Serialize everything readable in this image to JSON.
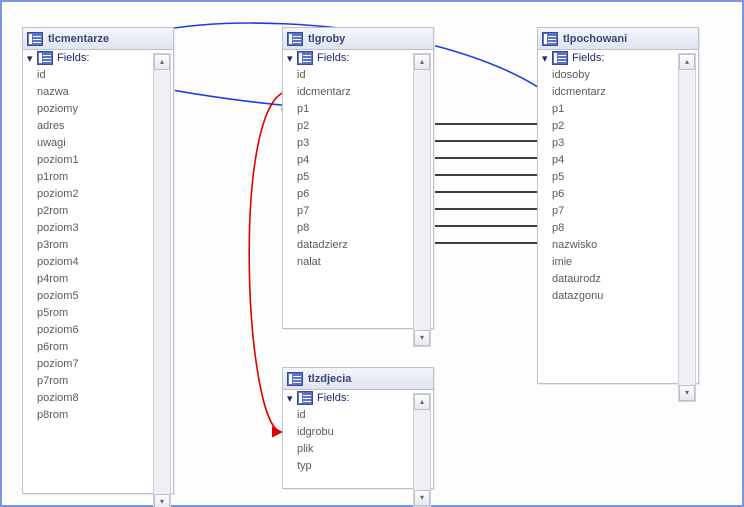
{
  "fieldsLabel": "Fields:",
  "tables": [
    {
      "name": "tlcmentarze",
      "fields": [
        "id",
        "nazwa",
        "poziomy",
        "adres",
        "uwagi",
        "poziom1",
        "p1rom",
        "poziom2",
        "p2rom",
        "poziom3",
        "p3rom",
        "poziom4",
        "p4rom",
        "poziom5",
        "p5rom",
        "poziom6",
        "p6rom",
        "poziom7",
        "p7rom",
        "poziom8",
        "p8rom"
      ]
    },
    {
      "name": "tlgroby",
      "fields": [
        "id",
        "idcmentarz",
        "p1",
        "p2",
        "p3",
        "p4",
        "p5",
        "p6",
        "p7",
        "p8",
        "datadzierz",
        "nalat"
      ]
    },
    {
      "name": "tlpochowani",
      "fields": [
        "idosoby",
        "idcmentarz",
        "p1",
        "p2",
        "p3",
        "p4",
        "p5",
        "p6",
        "p7",
        "p8",
        "nazwisko",
        "imie",
        "dataurodz",
        "datazgonu"
      ]
    },
    {
      "name": "tlzdjecia",
      "fields": [
        "id",
        "idgrobu",
        "plik",
        "typ"
      ]
    }
  ],
  "relations": [
    {
      "from": "tlcmentarze.id",
      "to": "tlgroby.idcmentarz",
      "color": "blue"
    },
    {
      "from": "tlcmentarze.id",
      "to": "tlpochowani.idcmentarz",
      "color": "blue"
    },
    {
      "from": "tlgroby.id",
      "to": "tlzdjecia.idgrobu",
      "color": "red"
    },
    {
      "from": "tlgroby.p1",
      "to": "tlpochowani.p1",
      "color": "black"
    },
    {
      "from": "tlgroby.p2",
      "to": "tlpochowani.p2",
      "color": "black"
    },
    {
      "from": "tlgroby.p3",
      "to": "tlpochowani.p3",
      "color": "black"
    },
    {
      "from": "tlgroby.p4",
      "to": "tlpochowani.p4",
      "color": "black"
    },
    {
      "from": "tlgroby.p5",
      "to": "tlpochowani.p5",
      "color": "black"
    },
    {
      "from": "tlgroby.p6",
      "to": "tlpochowani.p6",
      "color": "black"
    },
    {
      "from": "tlgroby.p7",
      "to": "tlpochowani.p7",
      "color": "black"
    },
    {
      "from": "tlgroby.p8",
      "to": "tlpochowani.p8",
      "color": "black"
    }
  ]
}
